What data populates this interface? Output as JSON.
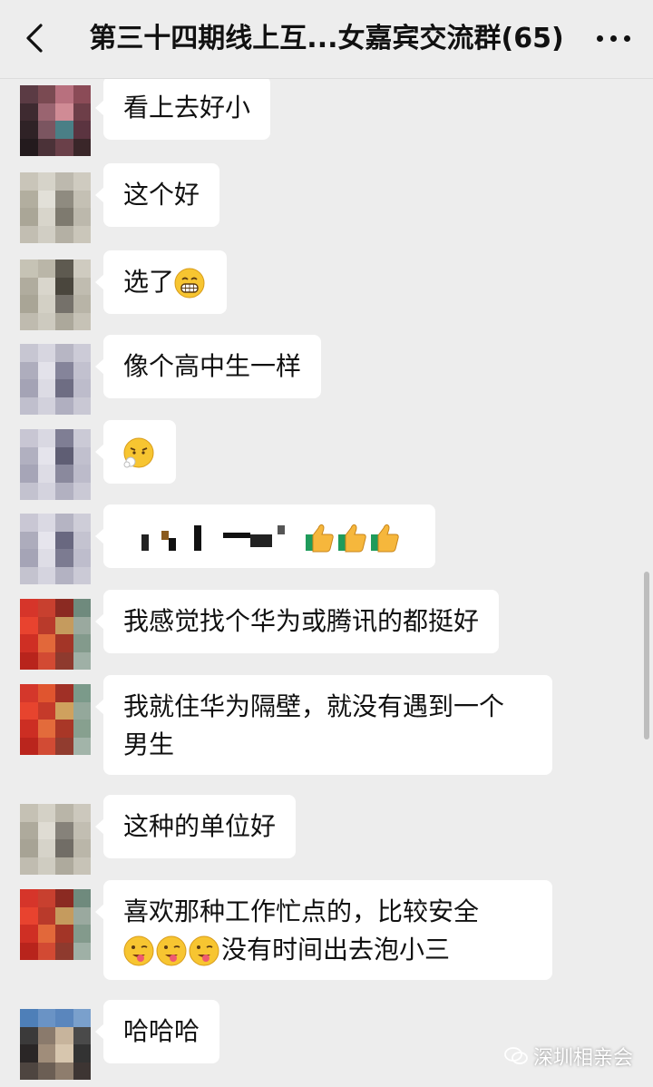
{
  "header": {
    "title": "第三十四期线上互...女嘉宾交流群(65)",
    "back_icon": "chevron-left-icon",
    "more_icon": "more-dots-icon"
  },
  "messages": [
    {
      "text": "看上去好小"
    },
    {
      "text": "这个好"
    },
    {
      "text": "选了",
      "emoji": "grin"
    },
    {
      "text": "像个高中生一样"
    },
    {
      "text": "",
      "emoji": "sigh"
    },
    {
      "text": "",
      "obscured": true,
      "trailing_emoji": "thumbs-up x3"
    },
    {
      "text": "我感觉找个华为或腾讯的都挺好"
    },
    {
      "lines": [
        "我就住华为隔壁，就没有遇到一个",
        "男生"
      ]
    },
    {
      "text": "这种的单位好"
    },
    {
      "line1": "喜欢那种工作忙点的，比较安全",
      "line2": "没有时间出去泡小三",
      "line2_emoji": "wink-tongue x3"
    },
    {
      "text": "哈哈哈"
    }
  ],
  "watermark": {
    "text": "深圳相亲会",
    "icon": "wechat-official-account-icon"
  },
  "colors": {
    "background": "#ededed",
    "bubble": "#ffffff",
    "text": "#111111"
  }
}
